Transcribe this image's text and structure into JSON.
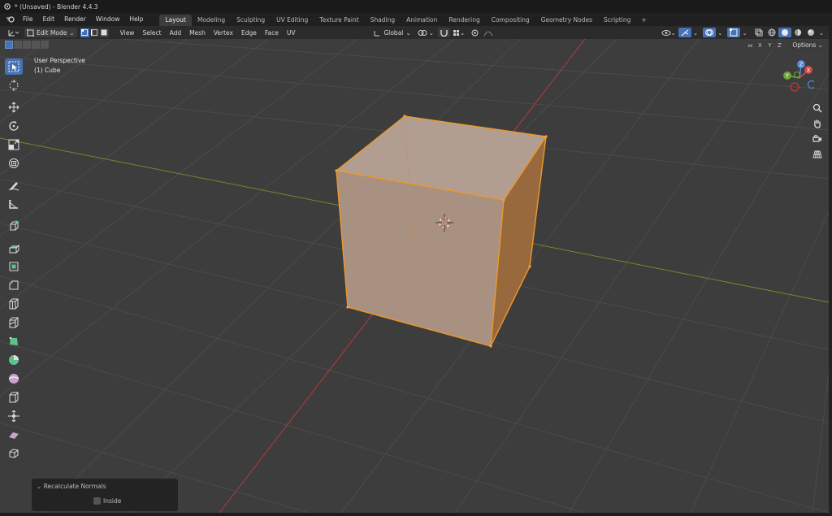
{
  "window": {
    "title": "* (Unsaved) - Blender 4.4.3"
  },
  "menu": [
    "File",
    "Edit",
    "Render",
    "Window",
    "Help"
  ],
  "tabs": [
    "Layout",
    "Modeling",
    "Sculpting",
    "UV Editing",
    "Texture Paint",
    "Shading",
    "Animation",
    "Rendering",
    "Compositing",
    "Geometry Nodes",
    "Scripting"
  ],
  "active_tab": "Layout",
  "tab_add": "+",
  "header": {
    "mode": "Edit Mode",
    "menus": [
      "View",
      "Select",
      "Add",
      "Mesh",
      "Vertex",
      "Edge",
      "Face",
      "UV"
    ],
    "orientation": "Global"
  },
  "viewport": {
    "view_name": "User Perspective",
    "object_name": "(1) Cube",
    "axis_x": "X",
    "axis_y": "Y",
    "axis_z": "Z",
    "options_label": "Options",
    "colors": {
      "background": "#3d3d3d",
      "grid": "#4a4a4a",
      "x_axis": "#c33b3b",
      "y_axis": "#6b9a2a",
      "cube_face": "#b89a88",
      "cube_side": "#9c7048",
      "selection": "#f0962a"
    }
  },
  "gizmo": {
    "x": "X",
    "y": "Y",
    "z": "Z"
  },
  "tools": [
    "select-box-icon",
    "cursor-icon",
    "move-icon",
    "rotate-icon",
    "scale-icon",
    "transform-icon",
    "annotate-icon",
    "measure-icon",
    "add-cube-icon",
    "extrude-icon",
    "inset-icon",
    "bevel-icon",
    "loop-cut-icon",
    "knife-icon",
    "poly-build-icon",
    "spin-icon",
    "smooth-icon",
    "edge-slide-icon",
    "shrink-fatten-icon",
    "shear-icon",
    "rip-icon"
  ],
  "operator_panel": {
    "title": "Recalculate Normals",
    "inside_label": "Inside"
  }
}
